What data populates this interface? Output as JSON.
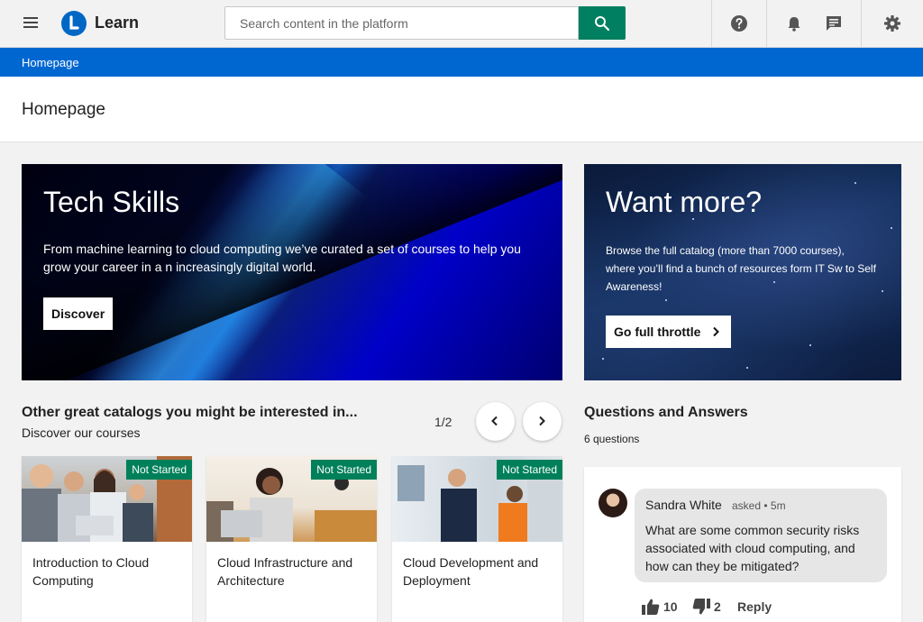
{
  "header": {
    "app_name": "Learn",
    "search_placeholder": "Search content in the platform",
    "icons": [
      "menu-icon",
      "search-icon",
      "help-icon",
      "bell-icon",
      "chat-icon",
      "gear-icon"
    ],
    "accent_color": "#008060"
  },
  "breadcrumb": {
    "items": [
      "Homepage"
    ],
    "color": "#0067d1"
  },
  "page": {
    "title": "Homepage"
  },
  "hero": {
    "title": "Tech Skills",
    "text": "From machine learning to cloud computing we’ve curated a set of courses to help you grow your career in a n increasingly digital world.",
    "button_label": "Discover"
  },
  "promo": {
    "title": "Want more?",
    "text": "Browse the full catalog (more than 7000 courses), where you’ll find a bunch of resources form IT Sw to Self Awareness!",
    "button_label": "Go full throttle"
  },
  "catalogs": {
    "title": "Other great catalogs you might be interested in...",
    "subtitle": "Discover our courses",
    "pager": "1/2",
    "courses": [
      {
        "status": "Not Started",
        "title": "Introduction to Cloud Computing"
      },
      {
        "status": "Not Started",
        "title": "Cloud Infrastructure and Architecture"
      },
      {
        "status": "Not Started",
        "title": "Cloud Development and Deployment"
      }
    ]
  },
  "qa": {
    "title": "Questions and Answers",
    "count": "6 questions",
    "question": {
      "author": "Sandra White",
      "meta": "asked • 5m",
      "text": "What are some common security risks associated with cloud computing, and how can they be mitigated?",
      "likes": "10",
      "dislikes": "2",
      "reply_label": "Reply"
    }
  }
}
